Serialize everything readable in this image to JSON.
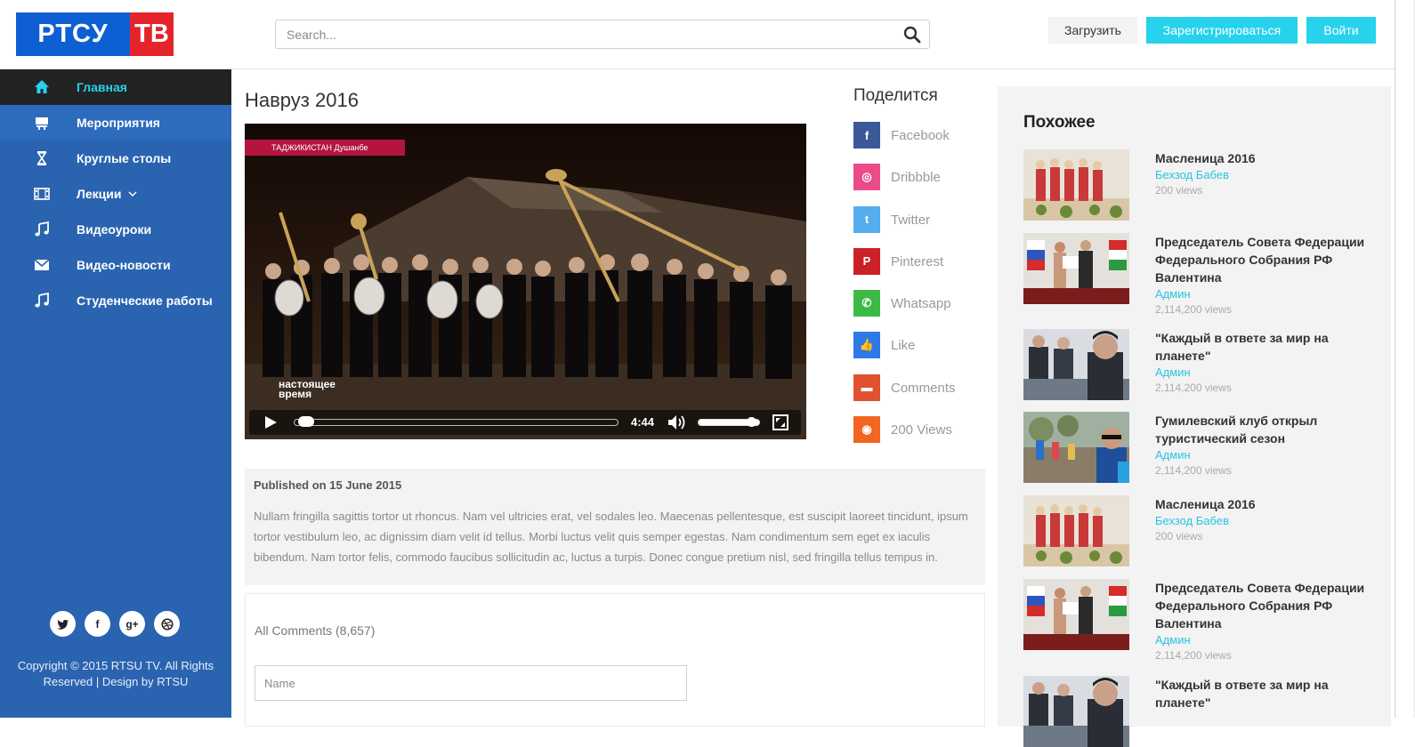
{
  "header": {
    "logo_left": "РТСУ",
    "logo_right": "ТВ",
    "search_placeholder": "Search...",
    "upload_label": "Загрузить",
    "register_label": "Зарегистрироваться",
    "login_label": "Войти"
  },
  "sidebar": {
    "items": [
      {
        "label": "Главная",
        "icon": "home-icon",
        "active": true
      },
      {
        "label": "Мероприятия",
        "icon": "presentation-icon"
      },
      {
        "label": "Круглые столы",
        "icon": "hourglass-icon"
      },
      {
        "label": "Лекции",
        "icon": "film-icon",
        "has_dropdown": true
      },
      {
        "label": "Видеоуроки",
        "icon": "music-note-icon"
      },
      {
        "label": "Видео-новости",
        "icon": "envelope-icon"
      },
      {
        "label": "Студенческие работы",
        "icon": "music-note-icon"
      }
    ],
    "social": [
      "twitter-icon",
      "facebook-icon",
      "google-plus-icon",
      "dribbble-icon"
    ],
    "copyright": "Copyright © 2015 RTSU TV. All Rights Reserved | Design by RTSU"
  },
  "video": {
    "title": "Навруз 2016",
    "overlay_caption": "ТАДЖИКИСТАН Душанбе",
    "overlay_brand_1": "настоящее",
    "overlay_brand_2": "время",
    "duration": "4:44",
    "progress": 0.02,
    "volume": 0.85
  },
  "share": {
    "title": "Поделится",
    "items": [
      {
        "label": "Facebook",
        "icon": "facebook-icon",
        "color": "#3b5998",
        "glyph": "f"
      },
      {
        "label": "Dribbble",
        "icon": "dribbble-icon",
        "color": "#ea4c89",
        "glyph": "◎"
      },
      {
        "label": "Twitter",
        "icon": "twitter-icon",
        "color": "#55acee",
        "glyph": "t"
      },
      {
        "label": "Pinterest",
        "icon": "pinterest-icon",
        "color": "#cb2027",
        "glyph": "P"
      },
      {
        "label": "Whatsapp",
        "icon": "whatsapp-icon",
        "color": "#3cba44",
        "glyph": "✆"
      },
      {
        "label": "Like",
        "icon": "thumbs-up-icon",
        "color": "#2d79e8",
        "glyph": "👍"
      },
      {
        "label": "Comments",
        "icon": "comment-icon",
        "color": "#e0522e",
        "glyph": "▬"
      },
      {
        "label": "200 Views",
        "icon": "eye-icon",
        "color": "#f26522",
        "glyph": "◉"
      }
    ]
  },
  "description": {
    "published": "Published on 15 June 2015",
    "text": "Nullam fringilla sagittis tortor ut rhoncus. Nam vel ultricies erat, vel sodales leo. Maecenas pellentesque, est suscipit laoreet tincidunt, ipsum tortor vestibulum leo, ac dignissim diam velit id tellus. Morbi luctus velit quis semper egestas. Nam condimentum sem eget ex iaculis bibendum. Nam tortor felis, commodo faucibus sollicitudin ac, luctus a turpis. Donec congue pretium nisl, sed fringilla tellus tempus in."
  },
  "comments": {
    "title": "All Comments (8,657)",
    "name_placeholder": "Name"
  },
  "related": {
    "title": "Похожее",
    "items": [
      {
        "title": "Масленица 2016",
        "author": "Бехзод Бабев",
        "views": "200 views",
        "thumb": "a"
      },
      {
        "title": "Председатель Совета Федерации Федерального Собрания РФ Валентина",
        "author": "Админ",
        "views": "2,114,200 views",
        "thumb": "b"
      },
      {
        "title": "\"Каждый в ответе за мир на планете\"",
        "author": "Админ",
        "views": "2,114,200 views",
        "thumb": "c"
      },
      {
        "title": "Гумилевский клуб открыл туристический сезон",
        "author": "Админ",
        "views": "2,114,200 views",
        "thumb": "d"
      },
      {
        "title": "Масленица 2016",
        "author": "Бехзод Бабев",
        "views": "200 views",
        "thumb": "a"
      },
      {
        "title": "Председатель Совета Федерации Федерального Собрания РФ Валентина",
        "author": "Админ",
        "views": "2,114,200 views",
        "thumb": "b"
      },
      {
        "title": "\"Каждый в ответе за мир на планете\"",
        "author": "",
        "views": "",
        "thumb": "c"
      }
    ]
  },
  "colors": {
    "accent": "#27d2ec",
    "sidebar": "#2a64b0",
    "logo_blue": "#0f5fd4",
    "logo_red": "#e5232b"
  }
}
